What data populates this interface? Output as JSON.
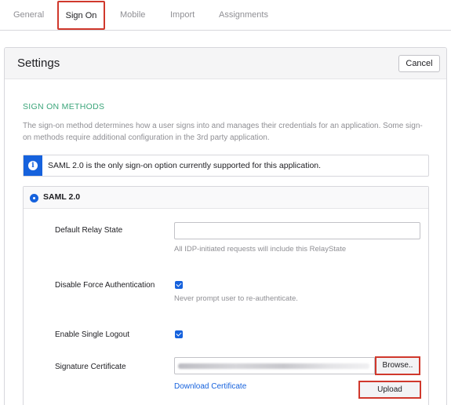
{
  "tabs": [
    {
      "label": "General",
      "active": false
    },
    {
      "label": "Sign On",
      "active": true
    },
    {
      "label": "Mobile",
      "active": false
    },
    {
      "label": "Import",
      "active": false
    },
    {
      "label": "Assignments",
      "active": false
    }
  ],
  "settings": {
    "title": "Settings",
    "cancel_label": "Cancel"
  },
  "sign_on_methods": {
    "heading": "SIGN ON METHODS",
    "description": "The sign-on method determines how a user signs into and manages their credentials for an application. Some sign-on methods require additional configuration in the 3rd party application.",
    "info_text": "SAML 2.0 is the only sign-on option currently supported for this application.",
    "info_icon": "info-icon"
  },
  "saml": {
    "label": "SAML 2.0",
    "selected": true,
    "relay_state": {
      "label": "Default Relay State",
      "value": "",
      "help": "All IDP-initiated requests will include this RelayState"
    },
    "disable_force_auth": {
      "label": "Disable Force Authentication",
      "checked": true,
      "help": "Never prompt user to re-authenticate."
    },
    "single_logout": {
      "label": "Enable Single Logout",
      "checked": true
    },
    "signature_certificate": {
      "label": "Signature Certificate",
      "browse_label": "Browse..",
      "download_label": "Download Certificate",
      "upload_label": "Upload"
    }
  },
  "colors": {
    "accent": "#1662dd",
    "section_heading": "#3ba57a",
    "highlight_border": "#d0382c"
  }
}
